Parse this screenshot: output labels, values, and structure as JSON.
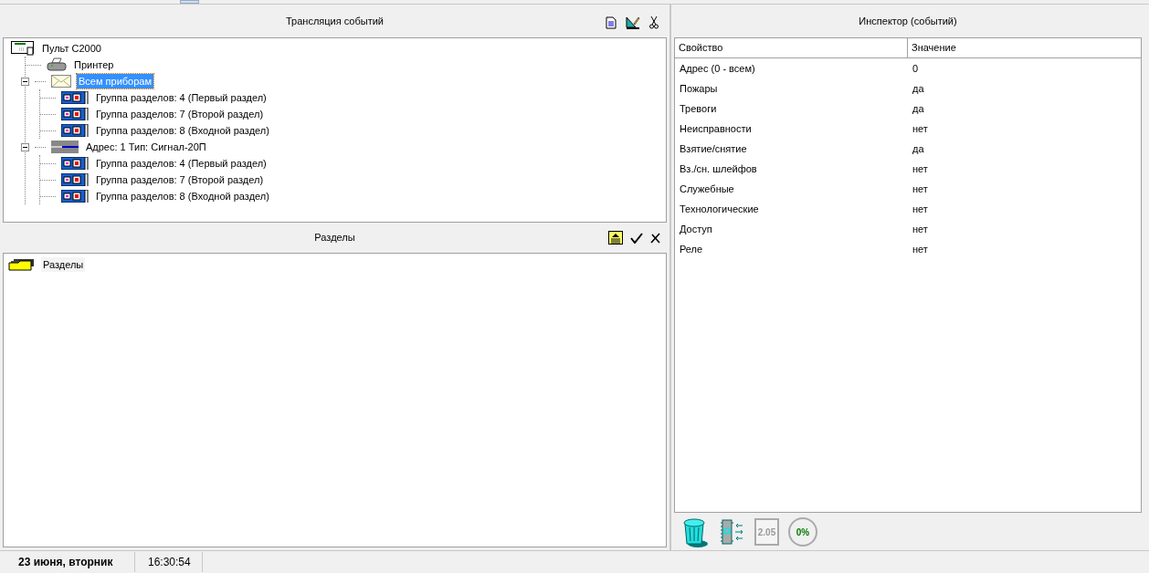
{
  "events_panel": {
    "title": "Трансляция событий",
    "tree": [
      {
        "label": "Пульт С2000",
        "kind": "console",
        "selected": false,
        "children": [
          {
            "label": "Принтер",
            "kind": "printer",
            "selected": false
          },
          {
            "label": "Всем приборам",
            "kind": "envelope",
            "selected": true,
            "children": [
              {
                "label": "Группа разделов: 4 (Первый раздел)",
                "kind": "group",
                "selected": false
              },
              {
                "label": "Группа разделов: 7 (Второй раздел)",
                "kind": "group",
                "selected": false
              },
              {
                "label": "Группа разделов: 8 (Входной раздел)",
                "kind": "group",
                "selected": false
              }
            ]
          },
          {
            "label": "Адрес: 1 Тип: Сигнал-20П",
            "kind": "device",
            "selected": false,
            "children": [
              {
                "label": "Группа разделов: 4 (Первый раздел)",
                "kind": "group",
                "selected": false
              },
              {
                "label": "Группа разделов: 7 (Второй раздел)",
                "kind": "group",
                "selected": false
              },
              {
                "label": "Группа разделов: 8 (Входной раздел)",
                "kind": "group",
                "selected": false
              }
            ]
          }
        ]
      }
    ]
  },
  "sections_panel": {
    "title": "Разделы",
    "tree": [
      {
        "label": "Разделы",
        "kind": "folder",
        "selected": false
      }
    ]
  },
  "inspector": {
    "title": "Инспектор (событий)",
    "columns": [
      "Свойство",
      "Значение"
    ],
    "rows": [
      [
        "Адрес (0 - всем)",
        "0"
      ],
      [
        "Пожары",
        "да"
      ],
      [
        "Тревоги",
        "да"
      ],
      [
        "Неисправности",
        "нет"
      ],
      [
        "Взятие/снятие",
        "да"
      ],
      [
        "Вз./сн. шлейфов",
        "нет"
      ],
      [
        "Служебные",
        "нет"
      ],
      [
        "Технологические",
        "нет"
      ],
      [
        "Доступ",
        "нет"
      ],
      [
        "Реле",
        "нет"
      ]
    ],
    "toolbar": {
      "version": "2.05",
      "progress": "0%"
    }
  },
  "status_bar": {
    "date": "23 июня, вторник",
    "time": "16:30:54"
  }
}
